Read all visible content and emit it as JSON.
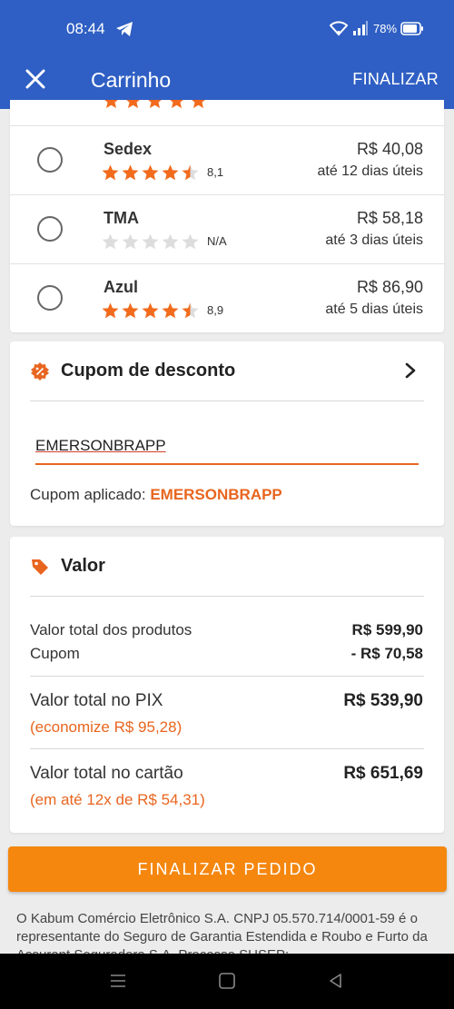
{
  "status_bar": {
    "time": "08:44",
    "battery": "78%"
  },
  "app_bar": {
    "title": "Carrinho",
    "finalize_label": "FINALIZAR"
  },
  "colors": {
    "brand_blue": "#2f5fc4",
    "accent_orange": "#e8651f",
    "cta_orange": "#f5870f",
    "star_orange": "#f26b1d",
    "star_empty": "#dddddd"
  },
  "shipping": {
    "options": [
      {
        "name": "Sedex",
        "stars": 4.5,
        "rating": "8,1",
        "price": "R$ 40,08",
        "eta": "até 12 dias úteis"
      },
      {
        "name": "TMA",
        "stars": 0,
        "rating": "N/A",
        "price": "R$ 58,18",
        "eta": "até 3 dias úteis"
      },
      {
        "name": "Azul",
        "stars": 4.5,
        "rating": "8,9",
        "price": "R$ 86,90",
        "eta": "até 5 dias úteis"
      }
    ]
  },
  "coupon": {
    "title": "Cupom de desconto",
    "input_value": "EMERSONBRAPP",
    "applied_label": "Cupom aplicado:",
    "applied_code": "EMERSONBRAPP"
  },
  "summary": {
    "title": "Valor",
    "products_label": "Valor total dos produtos",
    "products_value": "R$ 599,90",
    "coupon_label": "Cupom",
    "coupon_value": "- R$ 70,58",
    "pix_label": "Valor total no PIX",
    "pix_value": "R$ 539,90",
    "pix_note": "(economize R$ 95,28)",
    "card_label": "Valor total no cartão",
    "card_value": "R$ 651,69",
    "card_note": "(em até 12x de R$ 54,31)"
  },
  "cta": {
    "label": "FINALIZAR PEDIDO"
  },
  "legal_text": "O Kabum Comércio Eletrônico S.A. CNPJ 05.570.714/0001-59 é o representante do Seguro de Garantia Estendida e Roubo e Furto da Assurant Seguradora S.A. Processo SUSEP:"
}
